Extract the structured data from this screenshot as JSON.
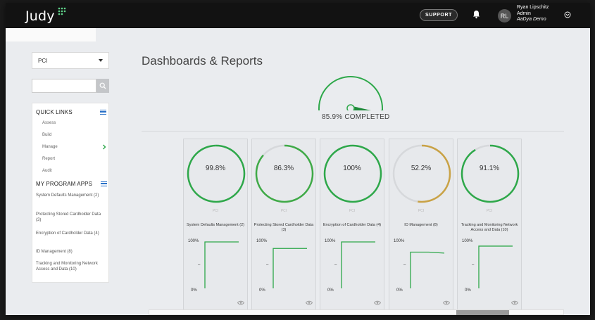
{
  "header": {
    "logo": "Judy",
    "support_label": "SUPPORT",
    "avatar_initials": "RL",
    "user_name": "Ryan Lipschitz",
    "user_role": "Admin",
    "user_org": "AaDya Demo"
  },
  "sidebar": {
    "framework_select": "PCI",
    "search_placeholder": "",
    "quick_links_title": "QUICK LINKS",
    "quick_links": [
      "Assess",
      "Build",
      "Manage",
      "Report",
      "Audit"
    ],
    "program_apps_title": "MY PROGRAM APPS",
    "program_apps": [
      "System Defaults Management (2)",
      "Protecting Stored Cardholder Data (3)",
      "Encryption of Cardholder Data (4)",
      "ID Management (8)",
      "Tracking and Monitoring Network Access and Data (10)"
    ]
  },
  "main": {
    "title": "Dashboards & Reports",
    "overall_completion": 85.9,
    "completed_label": "85.9% COMPLETED",
    "cards": [
      {
        "percent_label": "99.8%",
        "percent": 99.8,
        "color": "#2ea84a",
        "framework": "PCI",
        "name": "System Defaults Management (2)",
        "y_top": "100%",
        "y_mid": "–",
        "y_bottom": "0%",
        "trend": [
          0,
          100,
          100
        ]
      },
      {
        "percent_label": "86.3%",
        "percent": 86.3,
        "color": "#3faa47",
        "framework": "PCI",
        "name": "Protecting Stored Cardholder Data (3)",
        "y_top": "100%",
        "y_mid": "–",
        "y_bottom": "0%",
        "trend": [
          0,
          86,
          86
        ]
      },
      {
        "percent_label": "100%",
        "percent": 100,
        "color": "#2ea84a",
        "framework": "PCI",
        "name": "Encryption of Cardholder Data (4)",
        "y_top": "100%",
        "y_mid": "–",
        "y_bottom": "0%",
        "trend": [
          0,
          100,
          100
        ]
      },
      {
        "percent_label": "52.2%",
        "percent": 52.2,
        "color": "#c9a245",
        "framework": "PCI",
        "name": "ID Management (8)",
        "y_top": "100%",
        "y_mid": "–",
        "y_bottom": "0%",
        "trend": [
          0,
          78,
          76
        ]
      },
      {
        "percent_label": "91.1%",
        "percent": 91.1,
        "color": "#2ea84a",
        "framework": "PCI",
        "name": "Tracking and Monitoring Network Access and Data (10)",
        "y_top": "100%",
        "y_mid": "–",
        "y_bottom": "0%",
        "trend": [
          0,
          91,
          91
        ]
      }
    ]
  }
}
